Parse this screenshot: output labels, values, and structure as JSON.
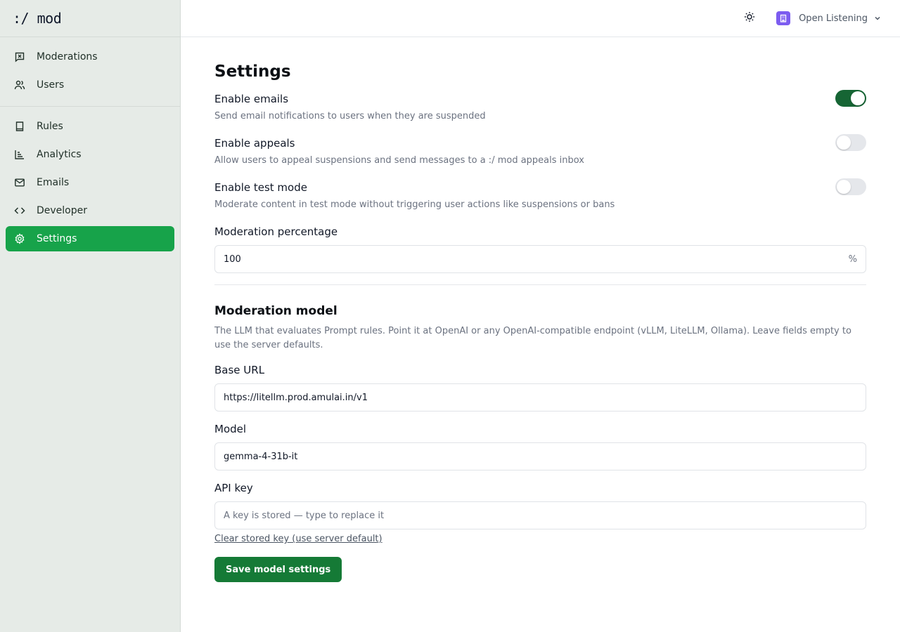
{
  "app": {
    "logo": ":/ mod"
  },
  "header": {
    "theme_icon": "sun-icon",
    "org_name": "Open Listening",
    "org_color": "#7c5cf0"
  },
  "sidebar": {
    "primary": [
      {
        "label": "Moderations",
        "icon": "flag-message-icon"
      },
      {
        "label": "Users",
        "icon": "users-icon"
      }
    ],
    "secondary": [
      {
        "label": "Rules",
        "icon": "book-icon"
      },
      {
        "label": "Analytics",
        "icon": "chart-icon"
      },
      {
        "label": "Emails",
        "icon": "mail-icon"
      },
      {
        "label": "Developer",
        "icon": "code-icon"
      },
      {
        "label": "Settings",
        "icon": "gear-icon",
        "active": true
      }
    ],
    "active_color": "#17a34a"
  },
  "page": {
    "title": "Settings",
    "settings": [
      {
        "title": "Enable emails",
        "desc": "Send email notifications to users when they are suspended",
        "enabled": true
      },
      {
        "title": "Enable appeals",
        "desc": "Allow users to appeal suspensions and send messages to a :/ mod appeals inbox",
        "enabled": false
      },
      {
        "title": "Enable test mode",
        "desc": "Moderate content in test mode without triggering user actions like suspensions or bans",
        "enabled": false
      }
    ],
    "moderation_percentage": {
      "label": "Moderation percentage",
      "value": "100",
      "suffix": "%"
    }
  },
  "model": {
    "title": "Moderation model",
    "desc": "The LLM that evaluates Prompt rules. Point it at OpenAI or any OpenAI-compatible endpoint (vLLM, LiteLLM, Ollama). Leave fields empty to use the server defaults.",
    "base_url": {
      "label": "Base URL",
      "value": "https://litellm.prod.amulai.in/v1"
    },
    "model": {
      "label": "Model",
      "value": "gemma-4-31b-it"
    },
    "api_key": {
      "label": "API key",
      "placeholder": "A key is stored — type to replace it"
    },
    "clear_link": "Clear stored key (use server default)",
    "save_label": "Save model settings",
    "save_color": "#157a36"
  }
}
